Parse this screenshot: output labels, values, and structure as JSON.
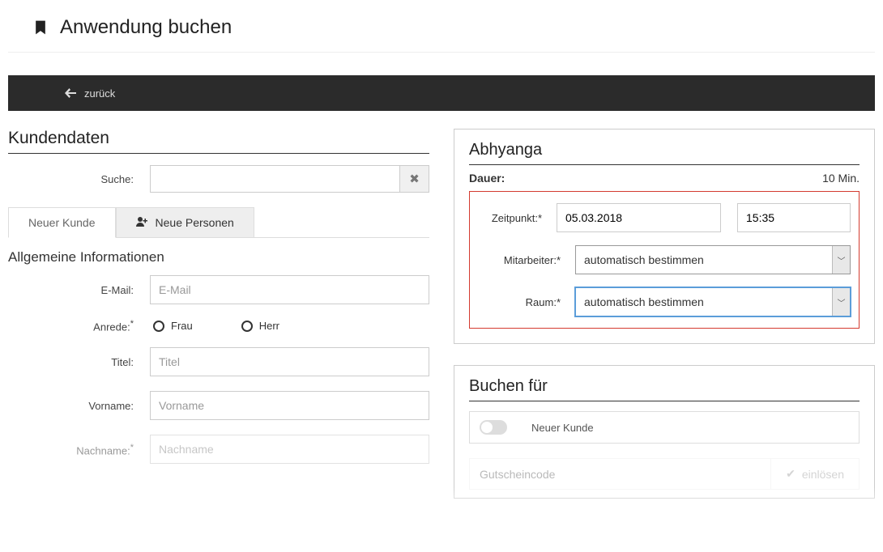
{
  "header": {
    "title": "Anwendung buchen"
  },
  "backbar": {
    "label": "zurück"
  },
  "left": {
    "section_title": "Kundendaten",
    "search_label": "Suche:",
    "search_placeholder": "",
    "tabs": {
      "new_customer": "Neuer Kunde",
      "new_persons": "Neue Personen"
    },
    "subsection": "Allgemeine Informationen",
    "fields": {
      "email_label": "E-Mail:",
      "email_placeholder": "E-Mail",
      "salutation_label": "Anrede:",
      "salutation_frau": "Frau",
      "salutation_herr": "Herr",
      "titel_label": "Titel:",
      "titel_placeholder": "Titel",
      "vorname_label": "Vorname:",
      "vorname_placeholder": "Vorname",
      "nachname_label": "Nachname:",
      "nachname_placeholder": "Nachname"
    }
  },
  "right": {
    "treatment_title": "Abhyanga",
    "duration_label": "Dauer:",
    "duration_value": "10 Min.",
    "fields": {
      "zeitpunkt_label": "Zeitpunkt:",
      "zeitpunkt_date": "05.03.2018",
      "zeitpunkt_time": "15:35",
      "mitarbeiter_label": "Mitarbeiter:",
      "mitarbeiter_value": "automatisch bestimmen",
      "raum_label": "Raum:",
      "raum_value": "automatisch bestimmen"
    },
    "book_for_title": "Buchen für",
    "book_for_label": "Neuer Kunde",
    "voucher_placeholder": "Gutscheincode",
    "redeem_label": "einlösen"
  }
}
